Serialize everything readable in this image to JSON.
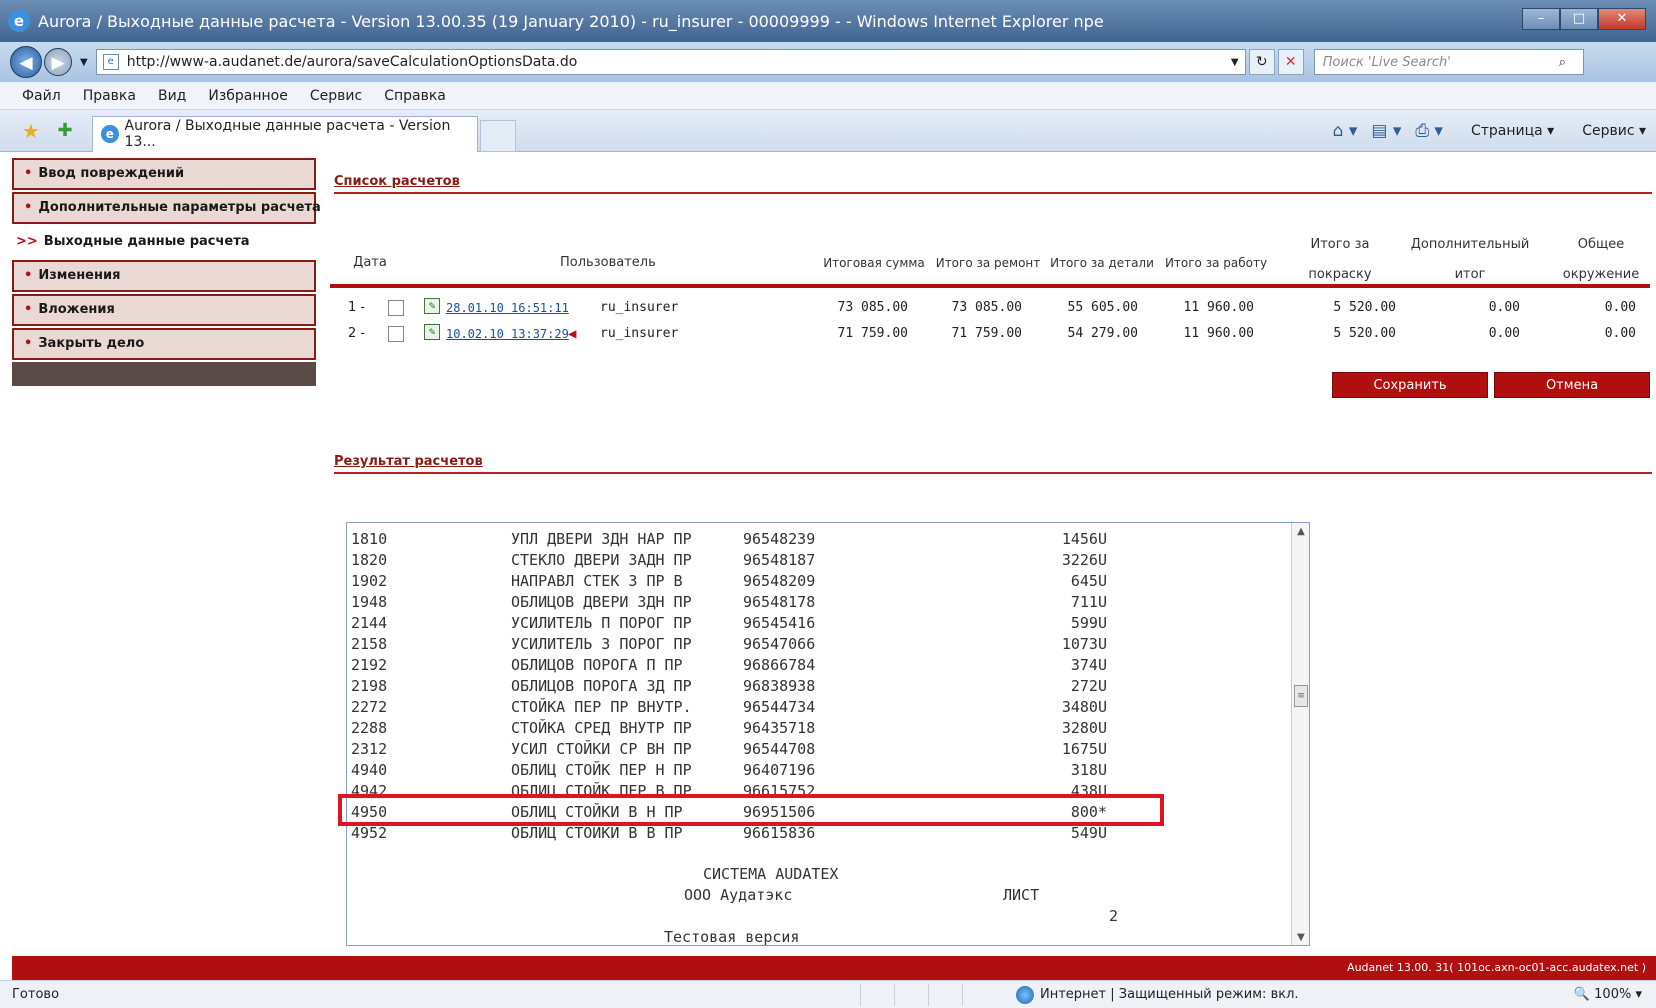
{
  "window": {
    "title": "Aurora / Выходные данные расчета - Version 13.00.35 (19 January 2010) - ru_insurer - 00009999 - - Windows Internet Explorer npe",
    "min_icon": "minimize-icon",
    "max_icon": "maximize-icon",
    "close_icon": "close-icon"
  },
  "address": {
    "url": "http://www-a.audanet.de/aurora/saveCalculationOptionsData.do",
    "search_placeholder": "Поиск 'Live Search'"
  },
  "menu": [
    "Файл",
    "Правка",
    "Вид",
    "Избранное",
    "Сервис",
    "Справка"
  ],
  "tab": {
    "label": "Aurora / Выходные данные расчета - Version 13..."
  },
  "tools": {
    "page": "Страница",
    "service": "Сервис"
  },
  "sidebar": {
    "items": [
      {
        "label": "Ввод повреждений",
        "prefix": "•"
      },
      {
        "label": "Дополнительные параметры расчета",
        "prefix": "•"
      },
      {
        "label": "Выходные данные расчета",
        "prefix": ">>"
      },
      {
        "label": "Изменения",
        "prefix": "•"
      },
      {
        "label": "Вложения",
        "prefix": "•"
      },
      {
        "label": "Закрыть дело",
        "prefix": "•"
      }
    ]
  },
  "calc_list": {
    "title": "Список расчетов",
    "headers": {
      "date": "Дата",
      "user": "Пользователь",
      "total": "Итоговая сумма",
      "repair": "Итого за ремонт",
      "parts": "Итого за детали",
      "work": "Итого за работу",
      "paint_1": "Итого за",
      "paint_2": "покраску",
      "extra_1": "Дополнительный",
      "extra_2": "итог",
      "env_1": "Общее",
      "env_2": "окружение"
    },
    "rows": [
      {
        "num": "1 -",
        "date": "28.01.10 16:51:11",
        "user": "ru_insurer",
        "total": "73 085.00",
        "repair": "73 085.00",
        "parts": "55 605.00",
        "work": "11 960.00",
        "paint": "5 520.00",
        "extra": "0.00",
        "env": "0.00"
      },
      {
        "num": "2 -",
        "date": "10.02.10 13:37:29",
        "user": "ru_insurer",
        "total": "71 759.00",
        "repair": "71 759.00",
        "parts": "54 279.00",
        "work": "11 960.00",
        "paint": "5 520.00",
        "extra": "0.00",
        "env": "0.00"
      }
    ],
    "save_label": "Сохранить",
    "cancel_label": "Отмена"
  },
  "results": {
    "title": "Результат расчетов",
    "lines": [
      {
        "code": "1810",
        "name": "УПЛ ДВЕРИ ЗДН НАР ПР",
        "part": "96548239",
        "price": "1456U"
      },
      {
        "code": "1820",
        "name": "СТЕКЛО ДВЕРИ ЗАДН ПР",
        "part": "96548187",
        "price": "3226U"
      },
      {
        "code": "1902",
        "name": "НАПРАВЛ СТЕК З ПР В",
        "part": "96548209",
        "price": "645U"
      },
      {
        "code": "1948",
        "name": "ОБЛИЦОВ ДВЕРИ ЗДН ПР",
        "part": "96548178",
        "price": "711U"
      },
      {
        "code": "2144",
        "name": "УСИЛИТЕЛЬ П ПОРОГ ПР",
        "part": "96545416",
        "price": "599U"
      },
      {
        "code": "2158",
        "name": "УСИЛИТЕЛЬ З ПОРОГ ПР",
        "part": "96547066",
        "price": "1073U"
      },
      {
        "code": "2192",
        "name": "ОБЛИЦОВ ПОРОГА П ПР",
        "part": "96866784",
        "price": "374U"
      },
      {
        "code": "2198",
        "name": "ОБЛИЦОВ ПОРОГА ЗД ПР",
        "part": "96838938",
        "price": "272U"
      },
      {
        "code": "2272",
        "name": "СТОЙКА ПЕР ПР ВНУТР.",
        "part": "96544734",
        "price": "3480U"
      },
      {
        "code": "2288",
        "name": "СТОЙКА СРЕД ВНУТР ПР",
        "part": "96435718",
        "price": "3280U"
      },
      {
        "code": "2312",
        "name": "УСИЛ СТОЙКИ СР ВН ПР",
        "part": "96544708",
        "price": "1675U"
      },
      {
        "code": "4940",
        "name": "ОБЛИЦ СТОЙК ПЕР Н ПР",
        "part": "96407196",
        "price": "318U"
      },
      {
        "code": "4942",
        "name": "ОБЛИЦ СТОЙК ПЕР В ПР",
        "part": "96615752",
        "price": "438U"
      },
      {
        "code": "4950",
        "name": "ОБЛИЦ СТОЙКИ В Н ПР",
        "part": "96951506",
        "price": "800*"
      },
      {
        "code": "4952",
        "name": "ОБЛИЦ СТОЙКИ В В ПР",
        "part": "96615836",
        "price": "549U"
      }
    ],
    "system": "СИСТЕМА AUDATEX",
    "sheet_label": "ЛИСТ",
    "sheet_num": "2",
    "company": "ООО Аудатэкс",
    "test": "Тестовая версия"
  },
  "footer": "Audanet 13.00. 31( 101oc.axn-oc01-acc.audatex.net )",
  "status": {
    "text": "Готово",
    "zone": "Интернет | Защищенный режим: вкл.",
    "zoom": "100%"
  }
}
